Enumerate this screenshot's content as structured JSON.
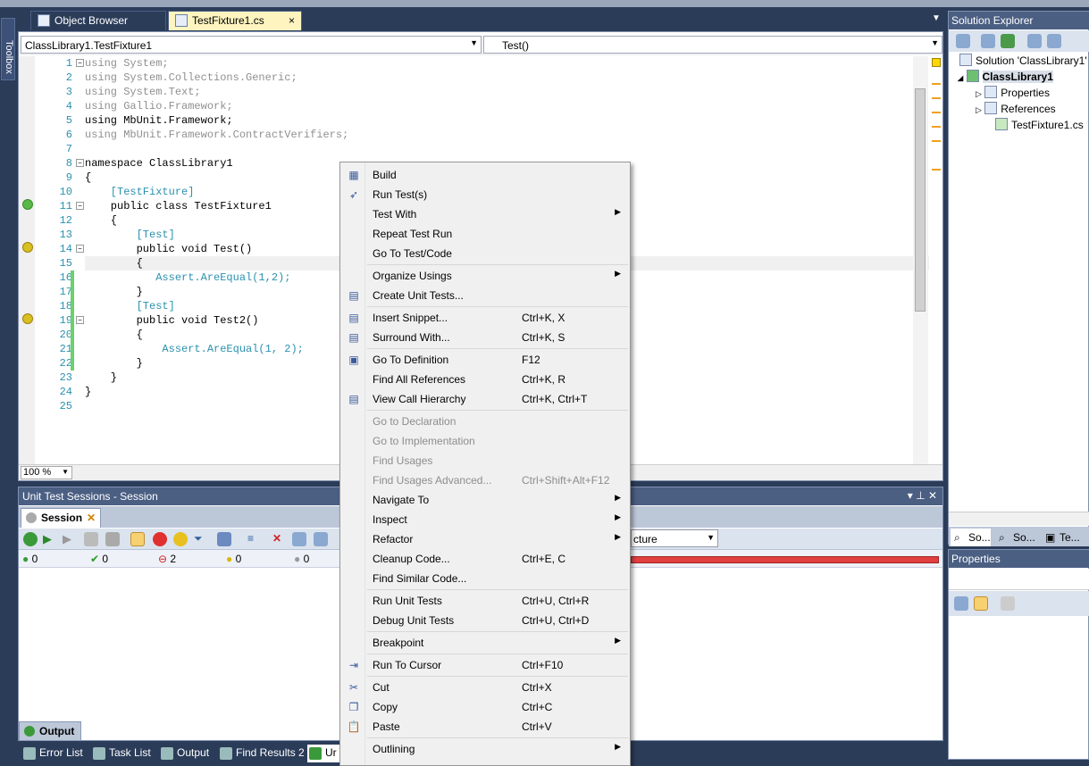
{
  "doc_tabs": [
    {
      "label": "Object Browser"
    },
    {
      "label": "TestFixture1.cs",
      "close": "×"
    }
  ],
  "toolbox_label": "Toolbox",
  "navbar": {
    "type_combo": "ClassLibrary1.TestFixture1",
    "member_combo": "Test()"
  },
  "code_lines": [
    {
      "n": "1",
      "t": "using System;"
    },
    {
      "n": "2",
      "t": "using System.Collections.Generic;"
    },
    {
      "n": "3",
      "t": "using System.Text;"
    },
    {
      "n": "4",
      "t": "using Gallio.Framework;"
    },
    {
      "n": "5",
      "t": "using MbUnit.Framework;"
    },
    {
      "n": "6",
      "t": "using MbUnit.Framework.ContractVerifiers;"
    },
    {
      "n": "7",
      "t": ""
    },
    {
      "n": "8",
      "t": "namespace ClassLibrary1"
    },
    {
      "n": "9",
      "t": "{"
    },
    {
      "n": "10",
      "t": "    [TestFixture]"
    },
    {
      "n": "11",
      "t": "    public class TestFixture1"
    },
    {
      "n": "12",
      "t": "    {"
    },
    {
      "n": "13",
      "t": "        [Test]"
    },
    {
      "n": "14",
      "t": "        public void Test()"
    },
    {
      "n": "15",
      "t": "        {"
    },
    {
      "n": "16",
      "t": "           Assert.AreEqual(1,2);"
    },
    {
      "n": "17",
      "t": "        }"
    },
    {
      "n": "18",
      "t": "        [Test]"
    },
    {
      "n": "19",
      "t": "        public void Test2()"
    },
    {
      "n": "20",
      "t": "        {"
    },
    {
      "n": "21",
      "t": "            Assert.AreEqual(1, 2);"
    },
    {
      "n": "22",
      "t": "        }"
    },
    {
      "n": "23",
      "t": "    }"
    },
    {
      "n": "24",
      "t": "}"
    },
    {
      "n": "25",
      "t": ""
    }
  ],
  "zoom": "100 %",
  "unit_test": {
    "title": "Unit Test Sessions - Session",
    "session_tab": "Session",
    "counts": {
      "total": "0",
      "passed": "0",
      "failed": "2",
      "ignored": "0",
      "unknown": "0"
    },
    "filter_combo": "cture",
    "output_tab": "Output"
  },
  "bottom_tabs": [
    "Error List",
    "Task List",
    "Output",
    "Find Results 2",
    "Ur"
  ],
  "solution_explorer": {
    "title": "Solution Explorer",
    "solution": "Solution 'ClassLibrary1'",
    "project": "ClassLibrary1",
    "items": [
      "Properties",
      "References",
      "TestFixture1.cs"
    ],
    "tabs": [
      "So...",
      "So...",
      "Te..."
    ]
  },
  "properties": {
    "title": "Properties"
  },
  "context_menu": [
    {
      "label": "Build",
      "icon": "build-icon",
      "glyph": "▦"
    },
    {
      "label": "Run Test(s)",
      "icon": "rocket-icon",
      "glyph": "➶"
    },
    {
      "label": "Test With",
      "arrow": "▶"
    },
    {
      "label": "Repeat Test Run"
    },
    {
      "label": "Go To Test/Code"
    },
    {
      "sep": true
    },
    {
      "label": "Organize Usings",
      "arrow": "▶"
    },
    {
      "label": "Create Unit Tests...",
      "icon": "unit-test-icon",
      "glyph": "▤"
    },
    {
      "sep": true
    },
    {
      "label": "Insert Snippet...",
      "shortcut": "Ctrl+K, X",
      "icon": "snippet-icon",
      "glyph": "▤"
    },
    {
      "label": "Surround With...",
      "shortcut": "Ctrl+K, S",
      "icon": "surround-icon",
      "glyph": "▤"
    },
    {
      "sep": true
    },
    {
      "label": "Go To Definition",
      "shortcut": "F12",
      "icon": "definition-icon",
      "glyph": "▣"
    },
    {
      "label": "Find All References",
      "shortcut": "Ctrl+K, R"
    },
    {
      "label": "View Call Hierarchy",
      "shortcut": "Ctrl+K, Ctrl+T",
      "icon": "hierarchy-icon",
      "glyph": "▤"
    },
    {
      "sep": true
    },
    {
      "label": "Go to Declaration",
      "disabled": true
    },
    {
      "label": "Go to Implementation",
      "disabled": true
    },
    {
      "label": "Find Usages",
      "disabled": true
    },
    {
      "label": "Find Usages Advanced...",
      "shortcut": "Ctrl+Shift+Alt+F12",
      "disabled": true
    },
    {
      "label": "Navigate To",
      "arrow": "▶"
    },
    {
      "label": "Inspect",
      "arrow": "▶"
    },
    {
      "label": "Refactor",
      "arrow": "▶"
    },
    {
      "label": "Cleanup Code...",
      "shortcut": "Ctrl+E, C"
    },
    {
      "label": "Find Similar Code..."
    },
    {
      "sep": true
    },
    {
      "label": "Run Unit Tests",
      "shortcut": "Ctrl+U, Ctrl+R"
    },
    {
      "label": "Debug Unit Tests",
      "shortcut": "Ctrl+U, Ctrl+D"
    },
    {
      "sep": true
    },
    {
      "label": "Breakpoint",
      "arrow": "▶"
    },
    {
      "sep": true
    },
    {
      "label": "Run To Cursor",
      "shortcut": "Ctrl+F10",
      "icon": "run-to-cursor-icon",
      "glyph": "⇥"
    },
    {
      "sep": true
    },
    {
      "label": "Cut",
      "shortcut": "Ctrl+X",
      "icon": "cut-icon",
      "glyph": "✂"
    },
    {
      "label": "Copy",
      "shortcut": "Ctrl+C",
      "icon": "copy-icon",
      "glyph": "❐"
    },
    {
      "label": "Paste",
      "shortcut": "Ctrl+V",
      "icon": "paste-icon",
      "glyph": "📋"
    },
    {
      "sep": true
    },
    {
      "label": "Outlining",
      "arrow": "▶"
    }
  ]
}
